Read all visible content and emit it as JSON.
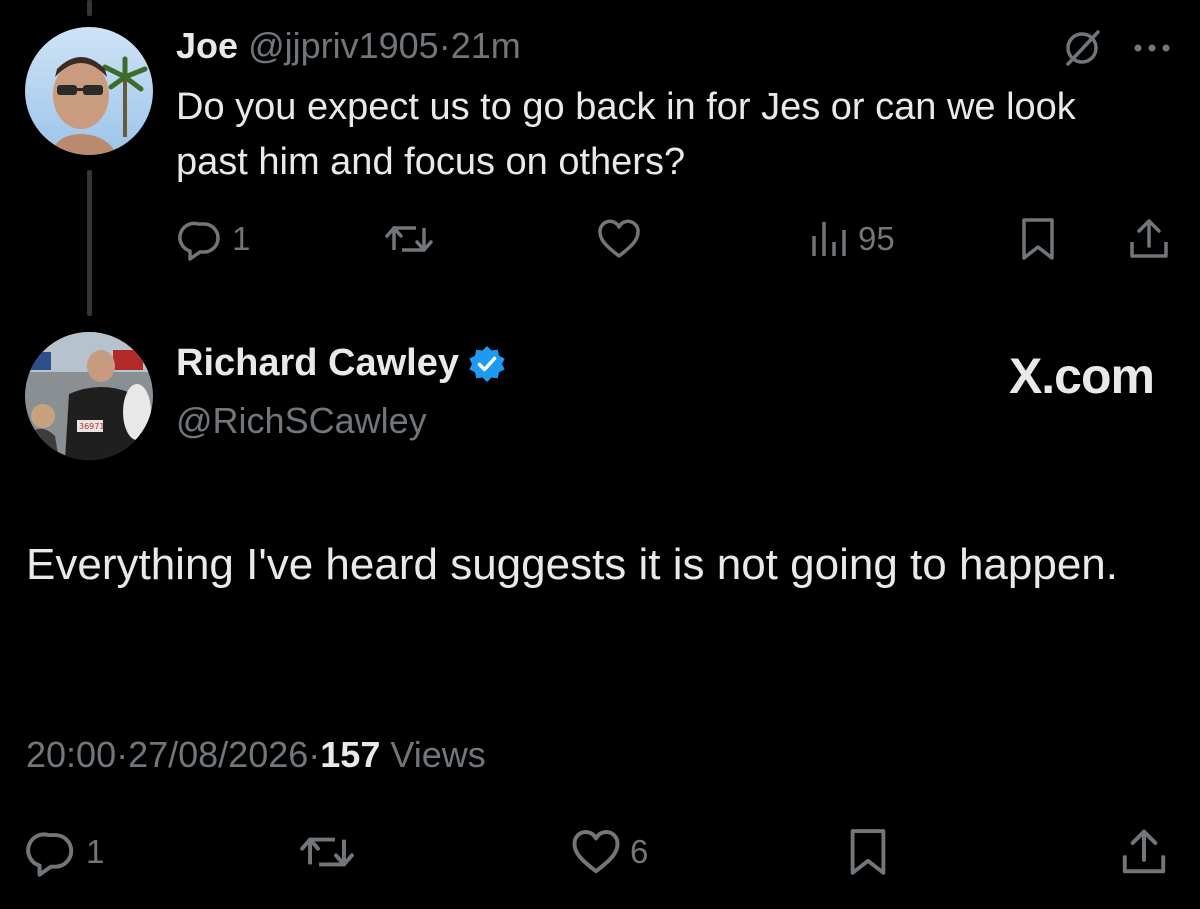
{
  "parent_tweet": {
    "name": "Joe",
    "handle": "@jjpriv1905",
    "separator": "·",
    "time": "21m",
    "text": "Do you expect us to go back in for Jes or can we look past him and focus on others?",
    "replies": "1",
    "views": "95",
    "icons": [
      "grok-icon",
      "more-options-icon",
      "reply-icon",
      "repost-icon",
      "like-icon",
      "views-icon",
      "bookmark-icon",
      "share-icon"
    ]
  },
  "main_tweet": {
    "name": "Richard Cawley",
    "handle": "@RichSCawley",
    "brand": "X.com",
    "text": "Everything I've heard suggests it is not going to happen.",
    "time": "20:00",
    "separator1": "·",
    "date": "27/08/2026",
    "separator2": "·",
    "views_count": "157",
    "views_label": "Views",
    "replies": "1",
    "likes": "6",
    "verified_color": "#1d9bf0"
  },
  "colors": {
    "background": "#000000",
    "text": "#e7e9ea",
    "muted": "#71767b",
    "thread_line": "#333639"
  }
}
